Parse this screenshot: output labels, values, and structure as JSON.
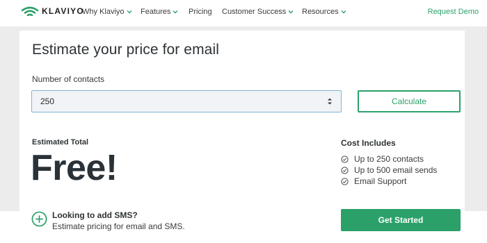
{
  "nav": {
    "brand": "KLAVIYO",
    "items": [
      {
        "label": "Why Klaviyo",
        "dropdown": true
      },
      {
        "label": "Features",
        "dropdown": true
      },
      {
        "label": "Pricing",
        "dropdown": false
      },
      {
        "label": "Customer Success",
        "dropdown": true
      },
      {
        "label": "Resources",
        "dropdown": true
      }
    ],
    "cta": "Request Demo"
  },
  "estimator": {
    "title": "Estimate your price for email",
    "contacts_label": "Number of contacts",
    "contacts_value": "250",
    "calculate_label": "Calculate",
    "estimated_total_label": "Estimated Total",
    "estimated_total_value": "Free!",
    "cost_includes_label": "Cost Includes",
    "cost_includes": [
      "Up to 250 contacts",
      "Up to 500 email sends",
      "Email Support"
    ]
  },
  "sms": {
    "title": "Looking to add SMS?",
    "subtitle": "Estimate pricing for email and SMS."
  },
  "get_started_label": "Get Started",
  "colors": {
    "accent": "#2ba169",
    "text": "#2d3235",
    "page_bg": "#ececec"
  },
  "icons": {
    "logo": "wifi-flag-logo-icon",
    "dropdown": "chevron-down-icon",
    "select": "select-arrows-icon",
    "check": "check-circle-icon",
    "sms": "plus-circle-icon"
  }
}
